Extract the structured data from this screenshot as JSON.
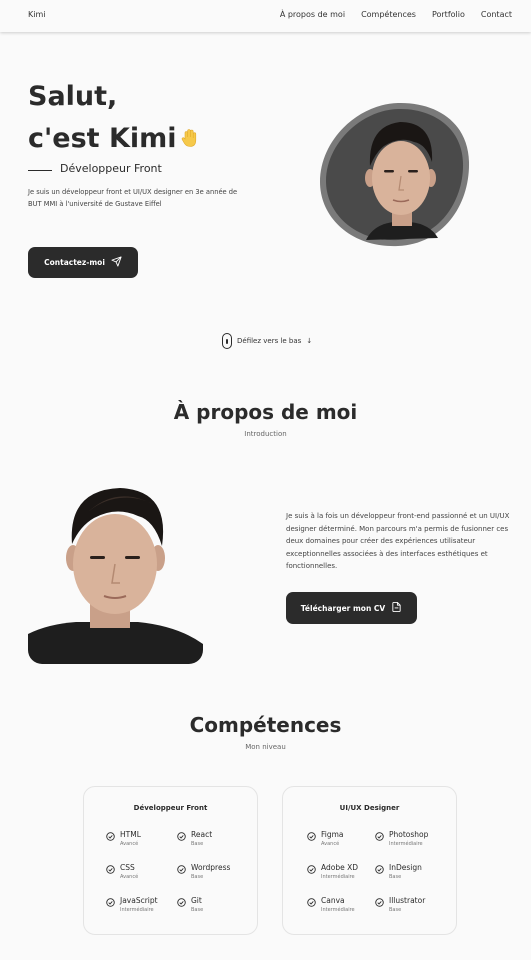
{
  "header": {
    "logo": "Kimi",
    "nav": [
      "À propos de moi",
      "Compétences",
      "Portfolio",
      "Contact"
    ]
  },
  "hero": {
    "title_line1": "Salut,",
    "title_line2": "c'est Kimi",
    "subtitle": "Développeur Front",
    "description": "Je suis un développeur front et UI/UX designer en 3e année de BUT MMI à l'université de Gustave Eiffel",
    "contact_button": "Contactez-moi",
    "scroll_hint": "Défilez vers le bas",
    "scroll_arrow": "↓"
  },
  "about": {
    "title": "À propos de moi",
    "subtitle": "Introduction",
    "text": "Je suis à la fois un développeur front-end passionné et un UI/UX designer déterminé. Mon parcours m'a permis de fusionner ces deux domaines pour créer des expériences utilisateur exceptionnelles associées à des interfaces esthétiques et fonctionnelles.",
    "cv_button": "Télécharger mon CV"
  },
  "skills": {
    "title": "Compétences",
    "subtitle": "Mon niveau",
    "cards": [
      {
        "title": "Développeur Front",
        "items": [
          {
            "name": "HTML",
            "level": "Avancé"
          },
          {
            "name": "React",
            "level": "Base"
          },
          {
            "name": "CSS",
            "level": "Avancé"
          },
          {
            "name": "Wordpress",
            "level": "Base"
          },
          {
            "name": "JavaScript",
            "level": "Intermédiaire"
          },
          {
            "name": "Git",
            "level": "Base"
          }
        ]
      },
      {
        "title": "UI/UX Designer",
        "items": [
          {
            "name": "Figma",
            "level": "Avancé"
          },
          {
            "name": "Photoshop",
            "level": "Intermédiaire"
          },
          {
            "name": "Adobe XD",
            "level": "Intermédiaire"
          },
          {
            "name": "InDesign",
            "level": "Base"
          },
          {
            "name": "Canva",
            "level": "Intermédiaire"
          },
          {
            "name": "Illustrator",
            "level": "Base"
          }
        ]
      }
    ]
  },
  "colors": {
    "background": "#fafafa",
    "text": "#2b2b2b",
    "button": "#2b2b2b",
    "blob": "#4b4b4b"
  },
  "icons": [
    "waving-hand-icon",
    "send-icon",
    "mouse-icon",
    "arrow-down-icon",
    "file-icon",
    "check-circle-icon"
  ]
}
